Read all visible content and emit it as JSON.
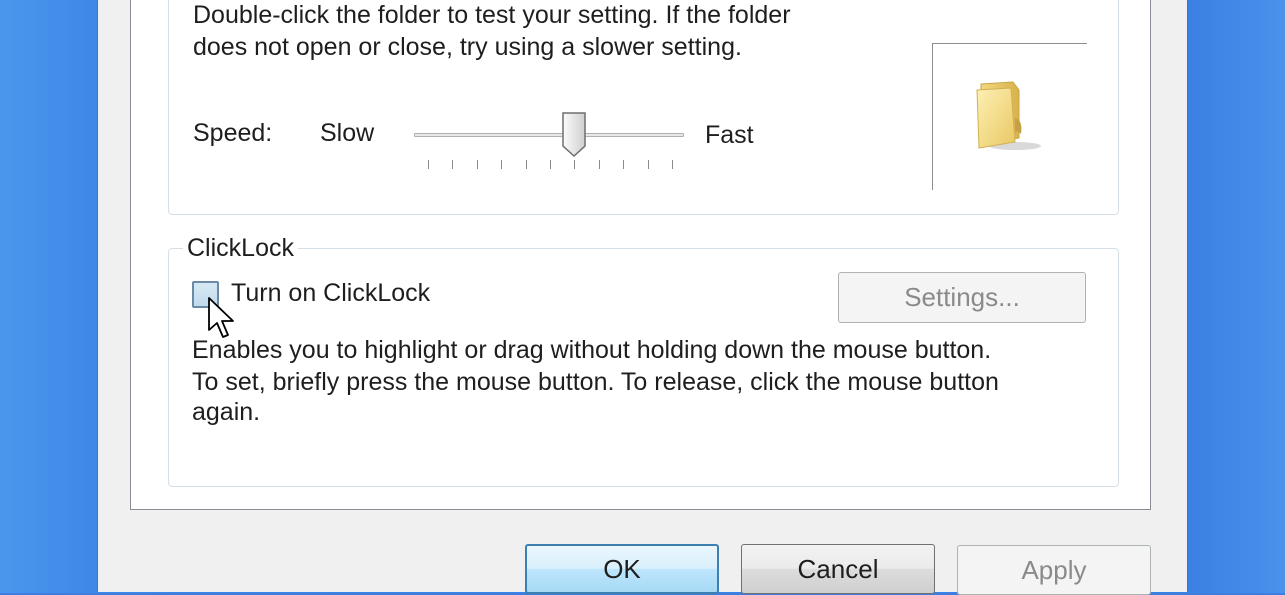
{
  "double_click_speed": {
    "instructions_line1": "Double-click the folder to test your setting. If the folder",
    "instructions_line2": "does not open or close, try using a slower setting.",
    "speed_label": "Speed:",
    "slow_label": "Slow",
    "fast_label": "Fast",
    "slider_position": 0.6,
    "tick_count": 11,
    "preview_icon": "folder-icon"
  },
  "clicklock": {
    "group_title": "ClickLock",
    "checkbox_label": "Turn on ClickLock",
    "checked": false,
    "settings_button": "Settings...",
    "description_line1": "Enables you to highlight or drag without holding down the mouse button.",
    "description_line2": "To set, briefly press the mouse button. To release, click the mouse button",
    "description_line3": "again."
  },
  "buttons": {
    "ok": "OK",
    "cancel": "Cancel",
    "apply": "Apply"
  },
  "colors": {
    "desktop": "#3c7fe0",
    "dialog": "#f0f0f0",
    "default_button_border": "#3c7fb1"
  }
}
